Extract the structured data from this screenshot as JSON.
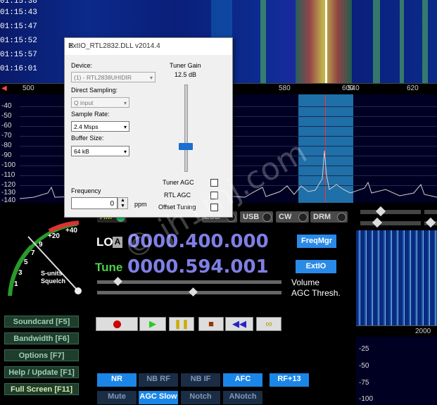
{
  "waterfall": {
    "times": [
      "01:15:38",
      "01:15:43",
      "01:15:47",
      "01:15:52",
      "01:15:57",
      "01:16:01"
    ]
  },
  "freq_axis": {
    "labels": [
      "500",
      "540",
      "580",
      "600",
      "620"
    ]
  },
  "spectrum": {
    "db_labels": [
      "-40",
      "-50",
      "-60",
      "-70",
      "-80",
      "-90",
      "-100",
      "-110",
      "-120",
      "-130",
      "-140"
    ]
  },
  "dialog": {
    "title": "ExtIO_RTL2832.DLL v2014.4",
    "device_label": "Device:",
    "device_value": "(1) - RTL2838UHIDIR",
    "direct_sampling_label": "Direct Sampling:",
    "direct_sampling_value": "Q input",
    "sample_rate_label": "Sample Rate:",
    "sample_rate_value": "2.4 Msps",
    "buffer_size_label": "Buffer Size:",
    "buffer_size_value": "64 kB",
    "tuner_gain_label": "Tuner Gain",
    "tuner_gain_value": "12.5 dB",
    "frequency_label": "Frequency",
    "frequency_value": "0",
    "ppm_label": "ppm",
    "tuner_agc_label": "Tuner AGC",
    "rtl_agc_label": "RTL AGC",
    "offset_tuning_label": "Offset Tuning"
  },
  "modes": [
    "AM",
    "LSB",
    "USB",
    "USB",
    "CW",
    "DRM"
  ],
  "meter": {
    "scale": [
      "+40",
      "+20",
      "9",
      "7",
      "5",
      "3",
      "1"
    ],
    "label1": "S-units",
    "label2": "Squelch"
  },
  "lo": {
    "label": "LO",
    "a_label": "A",
    "value": "0000.400.000"
  },
  "tune": {
    "label": "Tune",
    "value": "0000.594.001"
  },
  "buttons": {
    "freqmgr": "FreqMgr",
    "extio": "ExtIO",
    "volume": "Volume",
    "agc_thresh": "AGC Thresh.",
    "soundcard": "Soundcard [F5]",
    "bandwidth": "Bandwidth [F6]",
    "options": "Options  [F7]",
    "help": "Help / Update [F1]",
    "fullscreen": "Full Screen [F11]",
    "nr": "NR",
    "nb_rf": "NB RF",
    "nb_if": "NB IF",
    "afc": "AFC",
    "rf13": "RF+13",
    "mute": "Mute",
    "agc_slow": "AGC Slow",
    "notch": "Notch",
    "anotch": "ANotch"
  },
  "mini_spectrum": {
    "axis_label": "2000",
    "db_labels": [
      "-25",
      "-50",
      "-75",
      "-100"
    ]
  },
  "watermark": "© jh1rnj.com",
  "colors": {
    "green_btn": "#1e3d2c",
    "blue_btn": "#1b86e8",
    "freq_digits": "#7f7fe6"
  }
}
